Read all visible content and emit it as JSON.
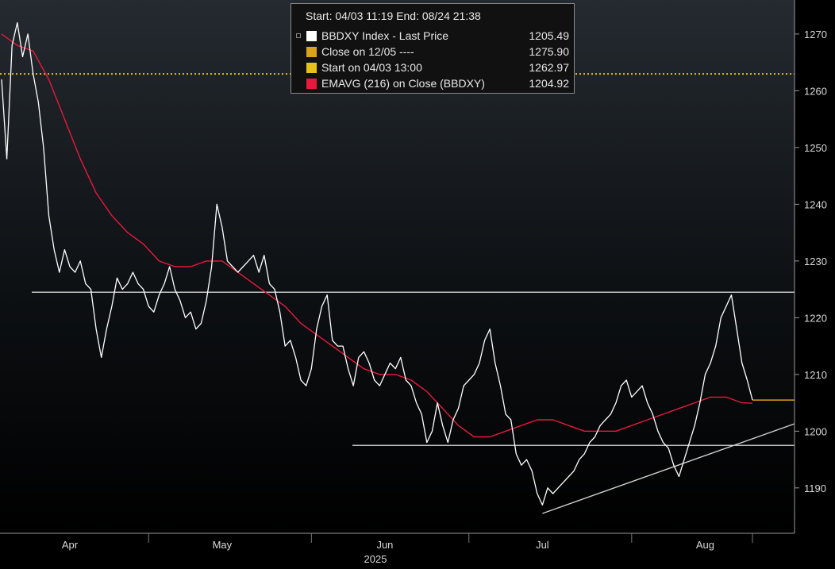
{
  "legend": {
    "header": "Start: 04/03 11:19 End: 08/24 21:38",
    "rows": [
      {
        "label": "BBDXY Index - Last Price",
        "value": "1205.49",
        "color": "#ffffff"
      },
      {
        "label": "Close on 12/05 ----",
        "value": "1275.90",
        "color": "#d9a21b"
      },
      {
        "label": "Start on 04/03 13:00",
        "value": "1262.97",
        "color": "#e6c21a"
      },
      {
        "label": "EMAVG (216)  on Close (BBDXY)",
        "value": "1204.92",
        "color": "#e8193c"
      }
    ]
  },
  "chart_data": {
    "type": "line",
    "background": "#000000",
    "x_axis": {
      "month_labels": [
        "Apr",
        "May",
        "Jun",
        "Jul",
        "Aug"
      ],
      "year_label": "2025"
    },
    "y_axis": {
      "position": "right",
      "ylim": [
        1182,
        1276
      ],
      "ticks": [
        1190,
        1200,
        1210,
        1220,
        1230,
        1240,
        1250,
        1260,
        1270
      ]
    },
    "series": [
      {
        "name": "BBDXY Index - Last Price",
        "color": "#ffffff",
        "points": [
          [
            "04/03",
            1262
          ],
          [
            "04/04",
            1248
          ],
          [
            "04/05",
            1268
          ],
          [
            "04/06",
            1272
          ],
          [
            "04/07",
            1266
          ],
          [
            "04/08",
            1270
          ],
          [
            "04/09",
            1263
          ],
          [
            "04/10",
            1258
          ],
          [
            "04/11",
            1250
          ],
          [
            "04/12",
            1238
          ],
          [
            "04/13",
            1232
          ],
          [
            "04/14",
            1228
          ],
          [
            "04/15",
            1232
          ],
          [
            "04/16",
            1229
          ],
          [
            "04/17",
            1228
          ],
          [
            "04/18",
            1230
          ],
          [
            "04/19",
            1226
          ],
          [
            "04/20",
            1225
          ],
          [
            "04/21",
            1218
          ],
          [
            "04/22",
            1213
          ],
          [
            "04/23",
            1218
          ],
          [
            "04/24",
            1222
          ],
          [
            "04/25",
            1227
          ],
          [
            "04/26",
            1225
          ],
          [
            "04/27",
            1226
          ],
          [
            "04/28",
            1228
          ],
          [
            "04/29",
            1226
          ],
          [
            "04/30",
            1225
          ],
          [
            "05/01",
            1222
          ],
          [
            "05/02",
            1221
          ],
          [
            "05/03",
            1224
          ],
          [
            "05/04",
            1226
          ],
          [
            "05/05",
            1229
          ],
          [
            "05/06",
            1225
          ],
          [
            "05/07",
            1223
          ],
          [
            "05/08",
            1220
          ],
          [
            "05/09",
            1221
          ],
          [
            "05/10",
            1218
          ],
          [
            "05/11",
            1219
          ],
          [
            "05/12",
            1223
          ],
          [
            "05/13",
            1229
          ],
          [
            "05/14",
            1240
          ],
          [
            "05/15",
            1236
          ],
          [
            "05/16",
            1230
          ],
          [
            "05/17",
            1229
          ],
          [
            "05/18",
            1228
          ],
          [
            "05/19",
            1229
          ],
          [
            "05/20",
            1230
          ],
          [
            "05/21",
            1231
          ],
          [
            "05/22",
            1228
          ],
          [
            "05/23",
            1231
          ],
          [
            "05/24",
            1226
          ],
          [
            "05/25",
            1225
          ],
          [
            "05/26",
            1221
          ],
          [
            "05/27",
            1215
          ],
          [
            "05/28",
            1216
          ],
          [
            "05/29",
            1213
          ],
          [
            "05/30",
            1209
          ],
          [
            "05/31",
            1208
          ],
          [
            "06/01",
            1211
          ],
          [
            "06/02",
            1218
          ],
          [
            "06/03",
            1222
          ],
          [
            "06/04",
            1224
          ],
          [
            "06/05",
            1216
          ],
          [
            "06/06",
            1215
          ],
          [
            "06/07",
            1215
          ],
          [
            "06/08",
            1211
          ],
          [
            "06/09",
            1208
          ],
          [
            "06/10",
            1213
          ],
          [
            "06/11",
            1214
          ],
          [
            "06/12",
            1212
          ],
          [
            "06/13",
            1209
          ],
          [
            "06/14",
            1208
          ],
          [
            "06/15",
            1210
          ],
          [
            "06/16",
            1212
          ],
          [
            "06/17",
            1211
          ],
          [
            "06/18",
            1213
          ],
          [
            "06/19",
            1209
          ],
          [
            "06/20",
            1208
          ],
          [
            "06/21",
            1205
          ],
          [
            "06/22",
            1203
          ],
          [
            "06/23",
            1198
          ],
          [
            "06/24",
            1200
          ],
          [
            "06/25",
            1205
          ],
          [
            "06/26",
            1201
          ],
          [
            "06/27",
            1198
          ],
          [
            "06/28",
            1202
          ],
          [
            "06/29",
            1204
          ],
          [
            "06/30",
            1208
          ],
          [
            "07/01",
            1209
          ],
          [
            "07/02",
            1210
          ],
          [
            "07/03",
            1212
          ],
          [
            "07/04",
            1216
          ],
          [
            "07/05",
            1218
          ],
          [
            "07/06",
            1212
          ],
          [
            "07/07",
            1208
          ],
          [
            "07/08",
            1203
          ],
          [
            "07/09",
            1202
          ],
          [
            "07/10",
            1196
          ],
          [
            "07/11",
            1194
          ],
          [
            "07/12",
            1195
          ],
          [
            "07/13",
            1193
          ],
          [
            "07/14",
            1189
          ],
          [
            "07/15",
            1187
          ],
          [
            "07/16",
            1190
          ],
          [
            "07/17",
            1189
          ],
          [
            "07/18",
            1190
          ],
          [
            "07/19",
            1191
          ],
          [
            "07/20",
            1192
          ],
          [
            "07/21",
            1193
          ],
          [
            "07/22",
            1195
          ],
          [
            "07/23",
            1196
          ],
          [
            "07/24",
            1198
          ],
          [
            "07/25",
            1199
          ],
          [
            "07/26",
            1201
          ],
          [
            "07/27",
            1202
          ],
          [
            "07/28",
            1203
          ],
          [
            "07/29",
            1205
          ],
          [
            "07/30",
            1208
          ],
          [
            "07/31",
            1209
          ],
          [
            "08/01",
            1206
          ],
          [
            "08/02",
            1207
          ],
          [
            "08/03",
            1208
          ],
          [
            "08/04",
            1205
          ],
          [
            "08/05",
            1203
          ],
          [
            "08/06",
            1200
          ],
          [
            "08/07",
            1198
          ],
          [
            "08/08",
            1197
          ],
          [
            "08/09",
            1194
          ],
          [
            "08/10",
            1192
          ],
          [
            "08/11",
            1195
          ],
          [
            "08/12",
            1198
          ],
          [
            "08/13",
            1201
          ],
          [
            "08/14",
            1205
          ],
          [
            "08/15",
            1210
          ],
          [
            "08/16",
            1212
          ],
          [
            "08/17",
            1215
          ],
          [
            "08/18",
            1220
          ],
          [
            "08/19",
            1222
          ],
          [
            "08/20",
            1224
          ],
          [
            "08/21",
            1218
          ],
          [
            "08/22",
            1212
          ],
          [
            "08/23",
            1209
          ],
          [
            "08/24",
            1205.49
          ]
        ]
      },
      {
        "name": "EMAVG (216)  on Close (BBDXY)",
        "color": "#e8193c",
        "points": [
          [
            "04/03",
            1270
          ],
          [
            "04/06",
            1268
          ],
          [
            "04/09",
            1267
          ],
          [
            "04/12",
            1262
          ],
          [
            "04/15",
            1255
          ],
          [
            "04/18",
            1248
          ],
          [
            "04/21",
            1242
          ],
          [
            "04/24",
            1238
          ],
          [
            "04/27",
            1235
          ],
          [
            "04/30",
            1233
          ],
          [
            "05/03",
            1230
          ],
          [
            "05/06",
            1229
          ],
          [
            "05/09",
            1229
          ],
          [
            "05/12",
            1230
          ],
          [
            "05/15",
            1230
          ],
          [
            "05/18",
            1228
          ],
          [
            "05/21",
            1226
          ],
          [
            "05/24",
            1224
          ],
          [
            "05/27",
            1222
          ],
          [
            "05/30",
            1219
          ],
          [
            "06/02",
            1217
          ],
          [
            "06/05",
            1215
          ],
          [
            "06/08",
            1213
          ],
          [
            "06/11",
            1211
          ],
          [
            "06/14",
            1210
          ],
          [
            "06/17",
            1210
          ],
          [
            "06/20",
            1209
          ],
          [
            "06/23",
            1207
          ],
          [
            "06/26",
            1204
          ],
          [
            "06/29",
            1201
          ],
          [
            "07/02",
            1199
          ],
          [
            "07/05",
            1199
          ],
          [
            "07/08",
            1200
          ],
          [
            "07/11",
            1201
          ],
          [
            "07/14",
            1202
          ],
          [
            "07/17",
            1202
          ],
          [
            "07/20",
            1201
          ],
          [
            "07/23",
            1200
          ],
          [
            "07/26",
            1200
          ],
          [
            "07/29",
            1200
          ],
          [
            "08/01",
            1201
          ],
          [
            "08/04",
            1202
          ],
          [
            "08/07",
            1203
          ],
          [
            "08/10",
            1204
          ],
          [
            "08/13",
            1205
          ],
          [
            "08/16",
            1206
          ],
          [
            "08/19",
            1206
          ],
          [
            "08/22",
            1205
          ],
          [
            "08/24",
            1204.92
          ]
        ]
      }
    ],
    "reference_lines": [
      {
        "name": "start-level-line",
        "type": "horizontal",
        "y": 1262.97,
        "color": "#e6c21a",
        "style": "dotted"
      },
      {
        "name": "close-level-line",
        "type": "horizontal-short",
        "y": 1205.49,
        "color": "#d9a21b"
      },
      {
        "name": "resistance-line",
        "type": "horizontal",
        "y": 1224.5,
        "color": "#ffffff"
      },
      {
        "name": "support-line",
        "type": "horizontal",
        "y": 1197.5,
        "color": "#ffffff"
      },
      {
        "name": "trend-line",
        "type": "diagonal",
        "from": [
          "07/15",
          1185.5
        ],
        "to": [
          "08/24",
          1201
        ],
        "color": "#cfcfcf"
      }
    ]
  }
}
